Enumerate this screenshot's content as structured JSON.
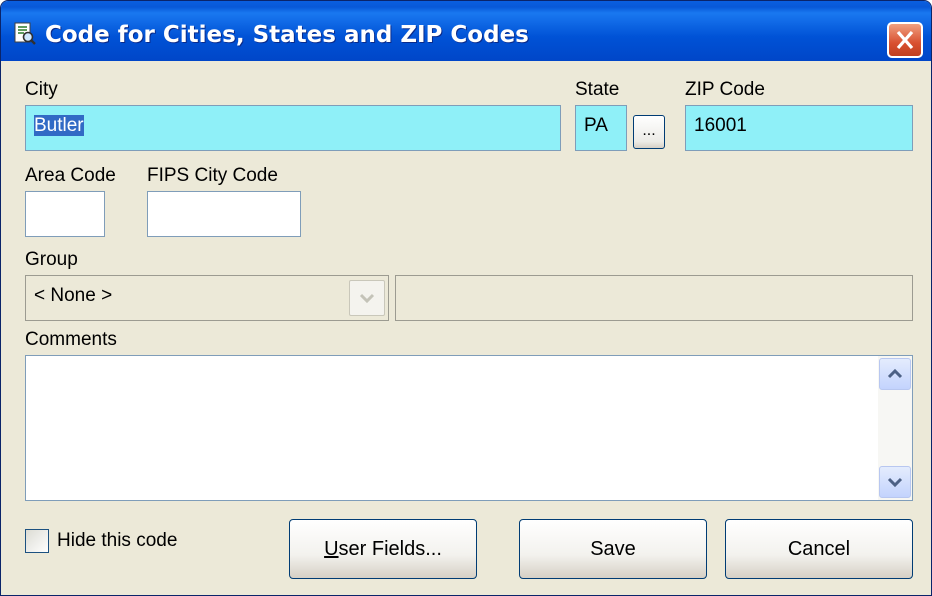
{
  "window": {
    "title": "Code for Cities, States and ZIP Codes"
  },
  "icons": {
    "app": "document-search-icon",
    "close": "close-icon",
    "dropdown": "chevron-down-icon",
    "scroll_up": "chevron-up-icon",
    "scroll_down": "chevron-down-icon"
  },
  "city": {
    "label": "City",
    "value": "Butler"
  },
  "state": {
    "label": "State",
    "value": "PA",
    "picker_label": "..."
  },
  "zip": {
    "label": "ZIP Code",
    "value": "16001"
  },
  "area_code": {
    "label": "Area Code",
    "value": ""
  },
  "fips": {
    "label": "FIPS City Code",
    "value": ""
  },
  "group": {
    "label": "Group",
    "selected": "< None >",
    "detail": ""
  },
  "comments": {
    "label": "Comments",
    "value": ""
  },
  "hide": {
    "label": "Hide this code",
    "checked": false
  },
  "buttons": {
    "user_fields_accel": "U",
    "user_fields_rest": "ser Fields...",
    "save": "Save",
    "cancel": "Cancel"
  },
  "colors": {
    "highlight_field": "#8ff0f8",
    "title_bar": "#0052d6",
    "close_button": "#d85030",
    "selection": "#316ac5"
  }
}
